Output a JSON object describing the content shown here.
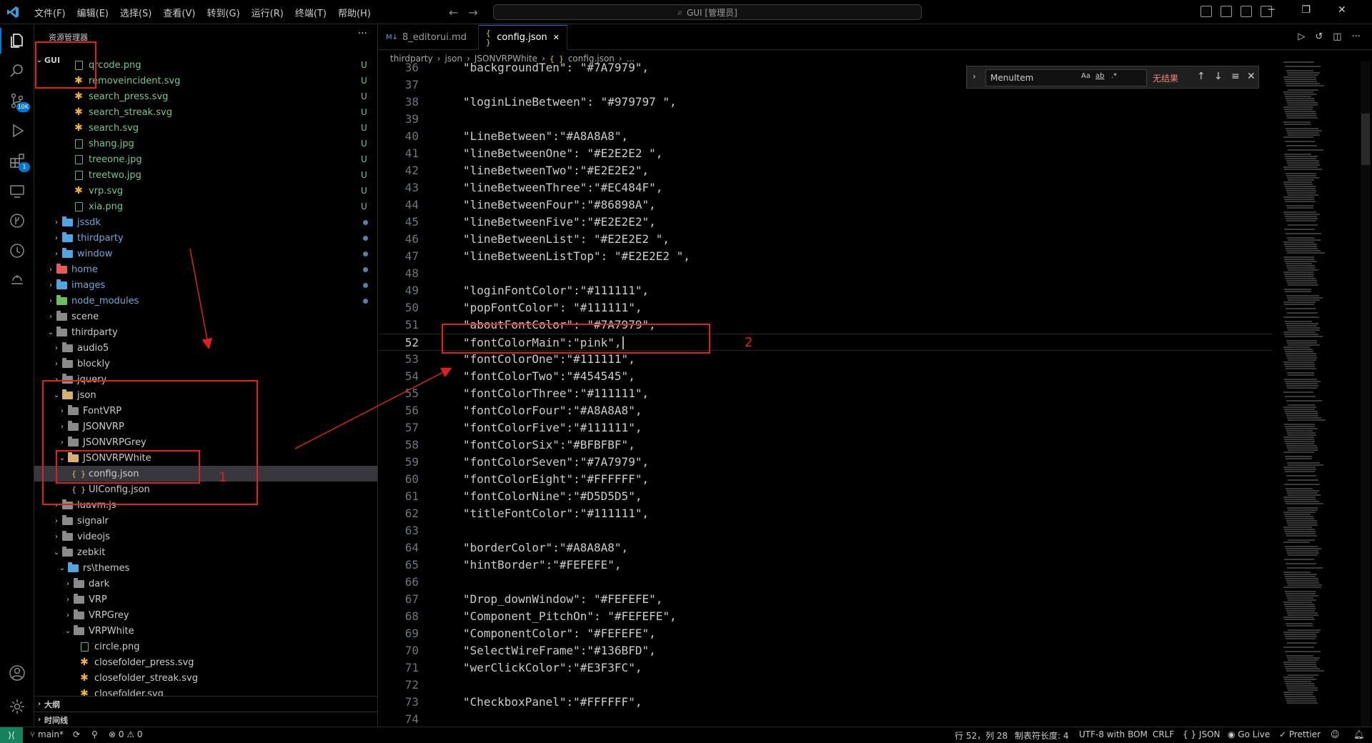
{
  "titlebar": {
    "menus": [
      "文件(F)",
      "编辑(E)",
      "选择(S)",
      "查看(V)",
      "转到(G)",
      "运行(R)",
      "终端(T)",
      "帮助(H)"
    ],
    "search": "GUI [管理员]",
    "nav_back": "←",
    "nav_forward": "→"
  },
  "activity": {
    "scm_badge": "10K",
    "extensions_badge": "1"
  },
  "sidebar": {
    "title": "资源管理器",
    "more": "···",
    "root": "GUI",
    "items": [
      {
        "name": "qrcode.png",
        "depth": 4,
        "kind": "image",
        "status": "U",
        "git": "u"
      },
      {
        "name": "removeincident.svg",
        "depth": 4,
        "kind": "svg",
        "status": "U",
        "git": "u"
      },
      {
        "name": "search_press.svg",
        "depth": 4,
        "kind": "svg",
        "status": "U",
        "git": "u"
      },
      {
        "name": "search_streak.svg",
        "depth": 4,
        "kind": "svg",
        "status": "U",
        "git": "u"
      },
      {
        "name": "search.svg",
        "depth": 4,
        "kind": "svg",
        "status": "U",
        "git": "u"
      },
      {
        "name": "shang.jpg",
        "depth": 4,
        "kind": "image",
        "status": "U",
        "git": "u"
      },
      {
        "name": "treeone.jpg",
        "depth": 4,
        "kind": "image",
        "status": "U",
        "git": "u"
      },
      {
        "name": "treetwo.jpg",
        "depth": 4,
        "kind": "image",
        "status": "U",
        "git": "u"
      },
      {
        "name": "vrp.svg",
        "depth": 4,
        "kind": "svg",
        "status": "U",
        "git": "u"
      },
      {
        "name": "xia.png",
        "depth": 4,
        "kind": "image",
        "status": "U",
        "git": "u"
      },
      {
        "name": "jssdk",
        "depth": 2,
        "kind": "folder",
        "color": "blue",
        "chev": "›",
        "dot": true,
        "git": "mod"
      },
      {
        "name": "thirdparty",
        "depth": 2,
        "kind": "folder",
        "color": "blue",
        "chev": "›",
        "dot": true,
        "git": "mod"
      },
      {
        "name": "window",
        "depth": 2,
        "kind": "folder",
        "color": "blue",
        "chev": "›",
        "dot": true,
        "git": "mod"
      },
      {
        "name": "home",
        "depth": 1,
        "kind": "folder",
        "color": "red",
        "chev": "›",
        "dot": true,
        "git": "mod"
      },
      {
        "name": "images",
        "depth": 1,
        "kind": "folder",
        "color": "blue",
        "chev": "›",
        "dot": true,
        "git": "mod"
      },
      {
        "name": "node_modules",
        "depth": 1,
        "kind": "folder",
        "color": "green",
        "chev": "›",
        "dot": true,
        "git": "mod"
      },
      {
        "name": "scene",
        "depth": 1,
        "kind": "folder",
        "color": "gray",
        "chev": "›"
      },
      {
        "name": "thirdparty",
        "depth": 1,
        "kind": "folder",
        "color": "gray",
        "chev": "⌄"
      },
      {
        "name": "audio5",
        "depth": 2,
        "kind": "folder",
        "color": "gray",
        "chev": "›"
      },
      {
        "name": "blockly",
        "depth": 2,
        "kind": "folder",
        "color": "gray",
        "chev": "›"
      },
      {
        "name": "jquery",
        "depth": 2,
        "kind": "folder",
        "color": "gray",
        "chev": "›"
      },
      {
        "name": "json",
        "depth": 2,
        "kind": "folder",
        "color": "open",
        "chev": "⌄"
      },
      {
        "name": "FontVRP",
        "depth": 3,
        "kind": "folder",
        "color": "gray",
        "chev": "›"
      },
      {
        "name": "JSONVRP",
        "depth": 3,
        "kind": "folder",
        "color": "gray",
        "chev": "›"
      },
      {
        "name": "JSONVRPGrey",
        "depth": 3,
        "kind": "folder",
        "color": "gray",
        "chev": "›"
      },
      {
        "name": "JSONVRPWhite",
        "depth": 3,
        "kind": "folder",
        "color": "open",
        "chev": "⌄"
      },
      {
        "name": "config.json",
        "depth": 4,
        "kind": "json",
        "selected": true
      },
      {
        "name": "UIConfig.json",
        "depth": 4,
        "kind": "json"
      },
      {
        "name": "luavm.js",
        "depth": 2,
        "kind": "folder",
        "color": "gray",
        "chev": "›"
      },
      {
        "name": "signalr",
        "depth": 2,
        "kind": "folder",
        "color": "gray",
        "chev": "›"
      },
      {
        "name": "videojs",
        "depth": 2,
        "kind": "folder",
        "color": "gray",
        "chev": "›"
      },
      {
        "name": "zebkit",
        "depth": 2,
        "kind": "folder",
        "color": "gray",
        "chev": "⌄"
      },
      {
        "name": "rs\\themes",
        "depth": 3,
        "kind": "folder",
        "color": "blue",
        "chev": "⌄"
      },
      {
        "name": "dark",
        "depth": 4,
        "kind": "folder",
        "color": "gray",
        "chev": "›"
      },
      {
        "name": "VRP",
        "depth": 4,
        "kind": "folder",
        "color": "gray",
        "chev": "›"
      },
      {
        "name": "VRPGrey",
        "depth": 4,
        "kind": "folder",
        "color": "gray",
        "chev": "›"
      },
      {
        "name": "VRPWhite",
        "depth": 4,
        "kind": "folder",
        "color": "gray",
        "chev": "⌄"
      },
      {
        "name": "circle.png",
        "depth": 5,
        "kind": "image"
      },
      {
        "name": "closefolder_press.svg",
        "depth": 5,
        "kind": "svg"
      },
      {
        "name": "closefolder_streak.svg",
        "depth": 5,
        "kind": "svg"
      },
      {
        "name": "closefolder.svg",
        "depth": 5,
        "kind": "svg"
      }
    ],
    "outline_label": "大纲",
    "timeline_label": "时间线"
  },
  "tabs": [
    {
      "label": "8_editorui.md",
      "icon": "M↓",
      "active": false
    },
    {
      "label": "config.json",
      "icon": "{ }",
      "active": true,
      "close": "✕"
    }
  ],
  "breadcrumbs": [
    "thirdparty",
    "json",
    "JSONVRPWhite",
    "config.json",
    "..."
  ],
  "find": {
    "query": "MenuItem",
    "match_case": "Aa",
    "whole_word": "ab",
    "regex": ".*",
    "result": "无结果"
  },
  "code": {
    "current_line": 52,
    "lines": [
      {
        "n": 36,
        "t": "\"backgroundTen\": \"#7A7979\","
      },
      {
        "n": 37,
        "t": ""
      },
      {
        "n": 38,
        "t": "\"loginLineBetween\": \"#979797 \","
      },
      {
        "n": 39,
        "t": ""
      },
      {
        "n": 40,
        "t": "\"LineBetween\":\"#A8A8A8\","
      },
      {
        "n": 41,
        "t": "\"lineBetweenOne\": \"#E2E2E2 \","
      },
      {
        "n": 42,
        "t": "\"lineBetweenTwo\":\"#E2E2E2\","
      },
      {
        "n": 43,
        "t": "\"lineBetweenThree\":\"#EC484F\","
      },
      {
        "n": 44,
        "t": "\"lineBetweenFour\":\"#86898A\","
      },
      {
        "n": 45,
        "t": "\"lineBetweenFive\":\"#E2E2E2\","
      },
      {
        "n": 46,
        "t": "\"lineBetweenList\": \"#E2E2E2 \","
      },
      {
        "n": 47,
        "t": "\"lineBetweenListTop\": \"#E2E2E2 \","
      },
      {
        "n": 48,
        "t": ""
      },
      {
        "n": 49,
        "t": "\"loginFontColor\":\"#111111\","
      },
      {
        "n": 50,
        "t": "\"popFontColor\": \"#111111\","
      },
      {
        "n": 51,
        "t": "\"aboutFontColor\": \"#7A7979\","
      },
      {
        "n": 52,
        "t": "\"fontColorMain\":\"pink\","
      },
      {
        "n": 53,
        "t": "\"fontColorOne\":\"#111111\","
      },
      {
        "n": 54,
        "t": "\"fontColorTwo\":\"#454545\","
      },
      {
        "n": 55,
        "t": "\"fontColorThree\":\"#111111\","
      },
      {
        "n": 56,
        "t": "\"fontColorFour\":\"#A8A8A8\","
      },
      {
        "n": 57,
        "t": "\"fontColorFive\":\"#111111\","
      },
      {
        "n": 58,
        "t": "\"fontColorSix\":\"#BFBFBF\","
      },
      {
        "n": 59,
        "t": "\"fontColorSeven\":\"#7A7979\","
      },
      {
        "n": 60,
        "t": "\"fontColorEight\":\"#FFFFFF\","
      },
      {
        "n": 61,
        "t": "\"fontColorNine\":\"#D5D5D5\","
      },
      {
        "n": 62,
        "t": "\"titleFontColor\":\"#111111\","
      },
      {
        "n": 63,
        "t": ""
      },
      {
        "n": 64,
        "t": "\"borderColor\":\"#A8A8A8\","
      },
      {
        "n": 65,
        "t": "\"hintBorder\":\"#FEFEFE\","
      },
      {
        "n": 66,
        "t": ""
      },
      {
        "n": 67,
        "t": "\"Drop_downWindow\": \"#FEFEFE\","
      },
      {
        "n": 68,
        "t": "\"Component_PitchOn\": \"#FEFEFE\","
      },
      {
        "n": 69,
        "t": "\"ComponentColor\": \"#FEFEFE\","
      },
      {
        "n": 70,
        "t": "\"SelectWireFrame\":\"#136BFD\","
      },
      {
        "n": 71,
        "t": "\"werClickColor\":\"#E3F3FC\","
      },
      {
        "n": 72,
        "t": ""
      },
      {
        "n": 73,
        "t": "\"CheckboxPanel\":\"#FFFFFF\","
      },
      {
        "n": 74,
        "t": ""
      }
    ]
  },
  "annotations": {
    "label_1": "1",
    "label_2": "2",
    "color": "#e02020"
  },
  "statusbar": {
    "branch": "main*",
    "errors": "0",
    "warnings": "0",
    "position": "行 52，列 28",
    "indent": "制表符长度: 4",
    "encoding": "UTF-8 with BOM",
    "eol": "CRLF",
    "language": "JSON",
    "golive": "Go Live",
    "prettier": "Prettier"
  },
  "colors": {
    "accent": "#0078d4",
    "untracked": "#73c991",
    "modified_folder": "#6fa8dc",
    "find_no_result": "#f48771"
  }
}
